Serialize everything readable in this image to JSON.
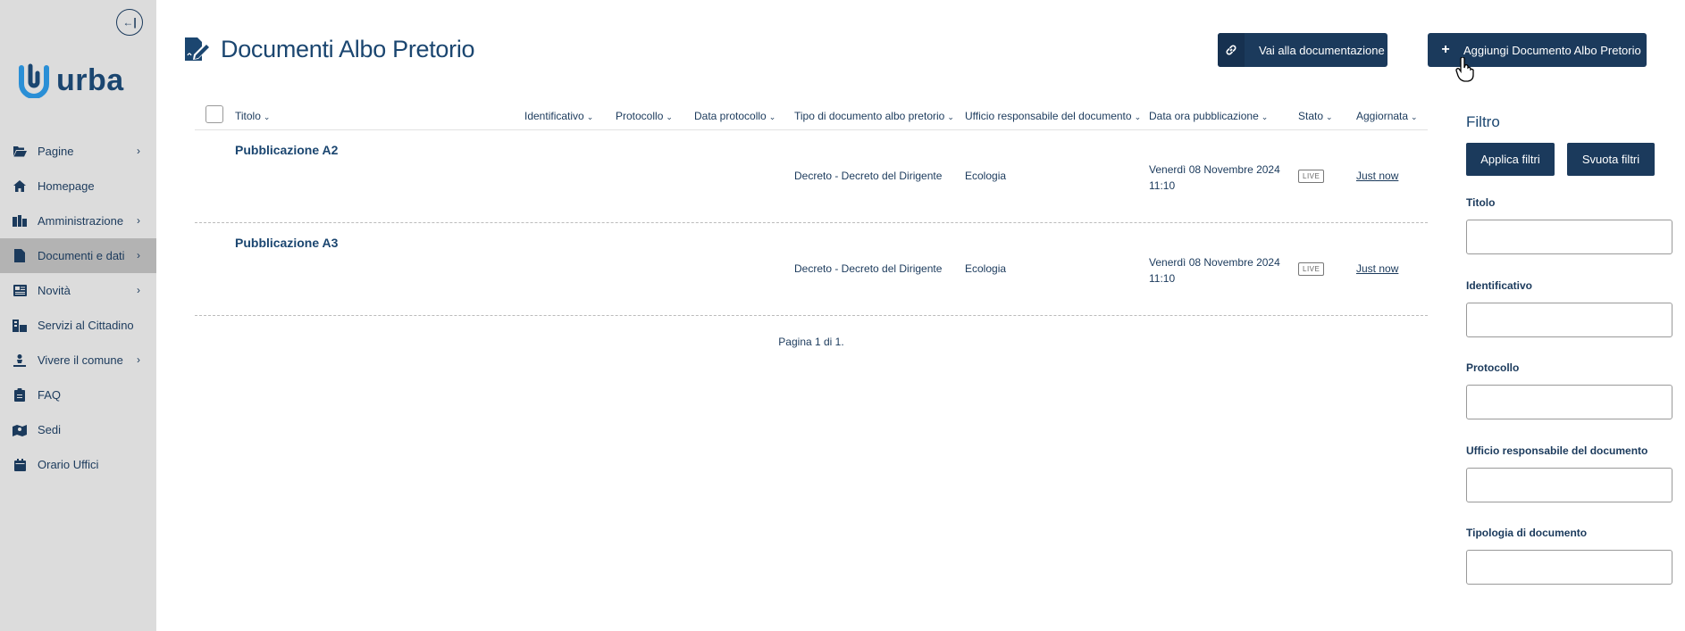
{
  "sidebar": {
    "collapse_label": "←|",
    "logo_text": "urba",
    "items": [
      {
        "label": "Pagine",
        "icon": "folder-open-icon",
        "chevron": true,
        "active": false
      },
      {
        "label": "Homepage",
        "icon": "home-icon",
        "chevron": false,
        "active": false
      },
      {
        "label": "Amministrazione",
        "icon": "buildings-icon",
        "chevron": true,
        "active": false
      },
      {
        "label": "Documenti e dati",
        "icon": "file-icon",
        "chevron": true,
        "active": true
      },
      {
        "label": "Novità",
        "icon": "newspaper-icon",
        "chevron": true,
        "active": false
      },
      {
        "label": "Servizi al Cittadino",
        "icon": "city-services-icon",
        "chevron": false,
        "active": false
      },
      {
        "label": "Vivere il comune",
        "icon": "person-icon",
        "chevron": true,
        "active": false
      },
      {
        "label": "FAQ",
        "icon": "clipboard-icon",
        "chevron": false,
        "active": false
      },
      {
        "label": "Sedi",
        "icon": "map-icon",
        "chevron": false,
        "active": false
      },
      {
        "label": "Orario Uffici",
        "icon": "calendar-icon",
        "chevron": false,
        "active": false
      }
    ]
  },
  "header": {
    "title": "Documenti Albo Pretorio",
    "doc_button": "Vai alla documentazione",
    "add_button": "Aggiungi Documento Albo Pretorio",
    "add_button_icon": "+"
  },
  "table": {
    "columns": [
      "Titolo",
      "Identificativo",
      "Protocollo",
      "Data protocollo",
      "Tipo di documento albo pretorio",
      "Ufficio responsabile del documento",
      "Data ora pubblicazione",
      "Stato",
      "Aggiornata"
    ],
    "rows": [
      {
        "title": "Pubblicazione A2",
        "tipo": "Decreto - Decreto del Dirigente",
        "ufficio": "Ecologia",
        "data_line1": "Venerdì 08 Novembre 2024",
        "data_line2": "11:10",
        "stato": "LIVE",
        "aggiornata": "Just now"
      },
      {
        "title": "Pubblicazione A3",
        "tipo": "Decreto - Decreto del Dirigente",
        "ufficio": "Ecologia",
        "data_line1": "Venerdì 08 Novembre 2024",
        "data_line2": "11:10",
        "stato": "LIVE",
        "aggiornata": "Just now"
      }
    ],
    "pager": "Pagina 1 di 1."
  },
  "filter": {
    "title": "Filtro",
    "apply_button": "Applica filtri",
    "clear_button": "Svuota filtri",
    "fields": [
      "Titolo",
      "Identificativo",
      "Protocollo",
      "Ufficio responsabile del documento",
      "Tipologia di documento"
    ]
  },
  "colors": {
    "primary": "#1b3a5c",
    "sidebar_bg": "#dcdcdc",
    "sidebar_active": "#b3b3b3"
  }
}
